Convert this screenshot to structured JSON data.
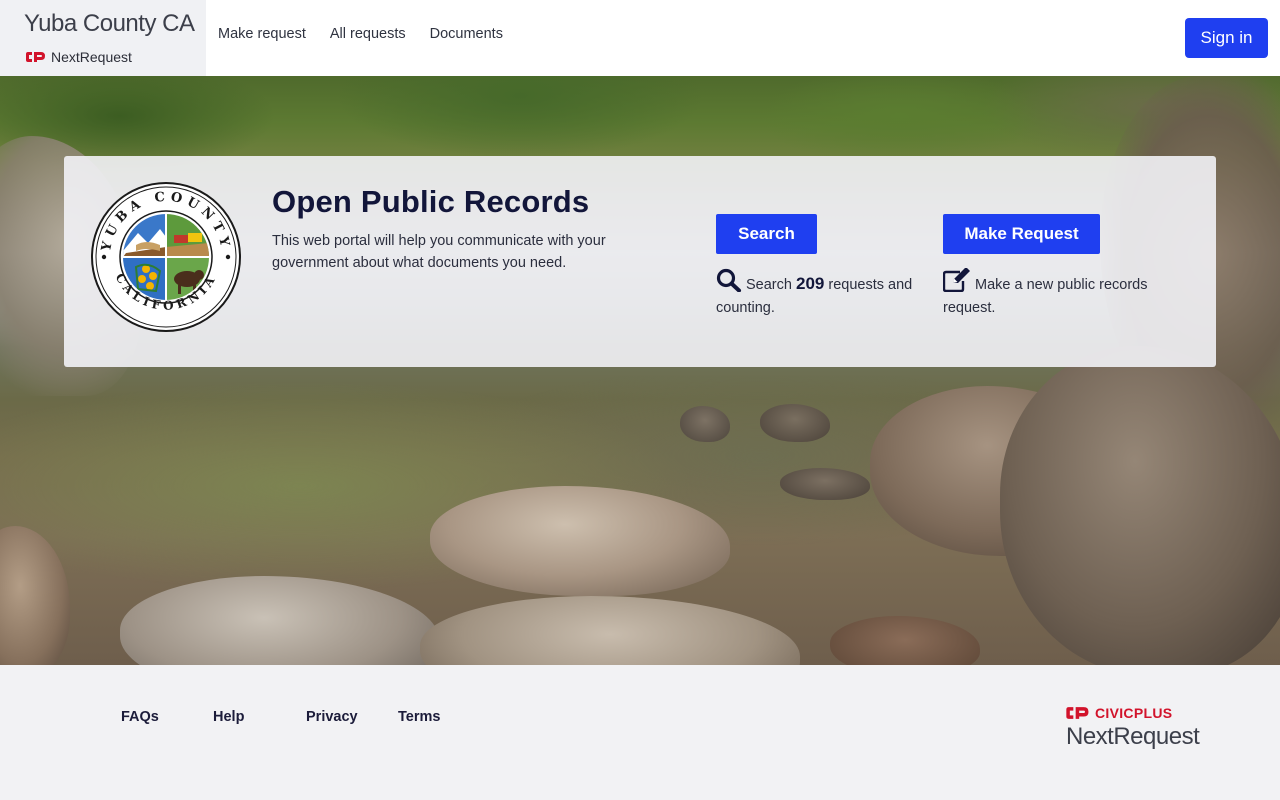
{
  "header": {
    "org_name": "Yuba County CA",
    "product_name": "NextRequest",
    "nav": [
      {
        "label": "Make request"
      },
      {
        "label": "All requests"
      },
      {
        "label": "Documents"
      }
    ],
    "sign_in_label": "Sign in"
  },
  "hero": {
    "title": "Open Public Records",
    "description": "This web portal will help you communicate with your government about what documents you need.",
    "seal": {
      "top_text": "YUBA COUNTY",
      "bottom_text": "CALIFORNIA"
    },
    "search": {
      "button_label": "Search",
      "text_before": "Search",
      "count": "209",
      "text_after": "requests and counting.",
      "icon": "search-icon"
    },
    "make_request": {
      "button_label": "Make Request",
      "text": "Make a new public records request.",
      "icon": "edit-icon"
    }
  },
  "footer": {
    "links": [
      {
        "label": "FAQs"
      },
      {
        "label": "Help"
      },
      {
        "label": "Privacy"
      },
      {
        "label": "Terms"
      }
    ],
    "logo_brand": "CIVICPLUS",
    "logo_product": "NextRequest"
  },
  "colors": {
    "primary_button": "#1f3ff0",
    "brand_red": "#d2132b",
    "title_navy": "#12163a"
  }
}
